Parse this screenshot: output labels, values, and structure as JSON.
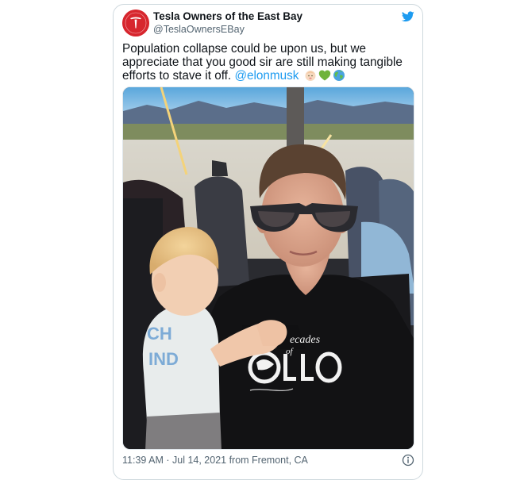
{
  "tweet": {
    "display_name": "Tesla Owners of the East Bay",
    "handle": "@TeslaOwnersEBay",
    "avatar_icon": "tesla-logo-icon",
    "brand_color": "#d7262e",
    "body_text": "Population collapse could be upon us, but we appreciate that you good sir are still making tangible efforts to stave it off.",
    "mention": "@elonmusk",
    "emojis": [
      "baby-icon",
      "green-heart-icon",
      "globe-icon"
    ],
    "timestamp": "11:39 AM · Jul 14, 2021 from Fremont, CA",
    "twitter_icon": "twitter-bird-icon",
    "info_icon": "info-icon",
    "accent_color": "#1d9bf0"
  },
  "photo": {
    "shirt_text": "ПLLO"
  }
}
